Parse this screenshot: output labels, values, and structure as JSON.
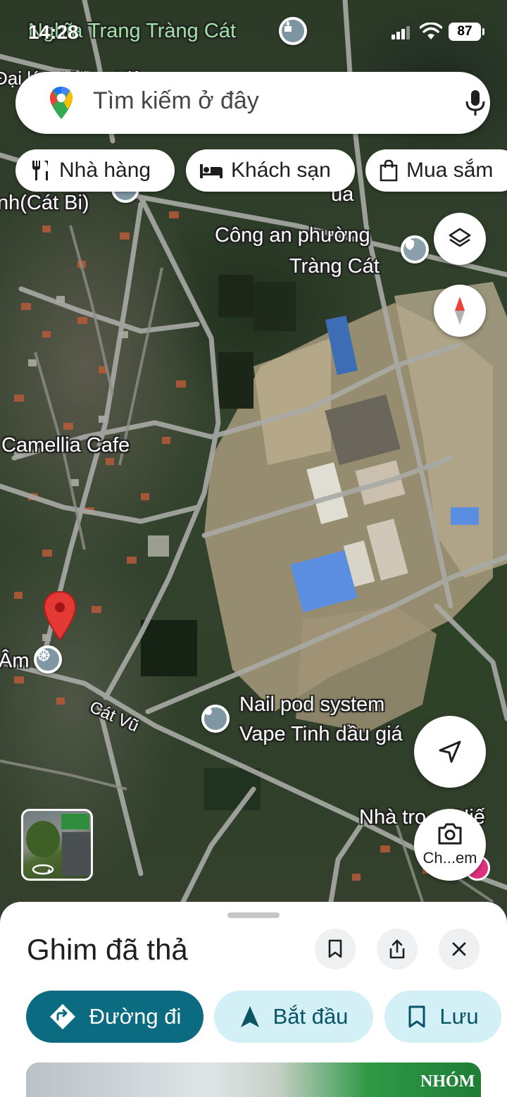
{
  "status_bar": {
    "time": "14:28",
    "battery": "87"
  },
  "search": {
    "placeholder": "Tìm kiếm ở đây"
  },
  "chips": [
    {
      "label": "Nhà hàng",
      "icon": "fork-knife-icon"
    },
    {
      "label": "Khách sạn",
      "icon": "bed-icon"
    },
    {
      "label": "Mua sắm",
      "icon": "shopping-bag-icon"
    }
  ],
  "map_labels": {
    "cemetery": "Nghĩa Trang Tràng Cát",
    "partial_top": "Đại lý ...t Nam Hiệp",
    "airport_partial_1": "ùa",
    "airport_partial_2": "nh(Cát Bi)",
    "police_line1": "Công an phường",
    "police_line2": "Tràng Cát",
    "cafe": "Camellia Cafe",
    "left_partial": "Âm",
    "street": "Cát Vũ",
    "shop_line1": "Nail pod system",
    "shop_line2": "Vape Tinh dầu giá",
    "guesthouse": "Nhà trọ ... Hiế",
    "camera_label": "Ch...em"
  },
  "bottom_sheet": {
    "title": "Ghim đã thả",
    "directions_label": "Đường đi",
    "start_label": "Bắt đầu",
    "save_label": "Lưu",
    "preview_text": "NHÓM"
  },
  "colors": {
    "primary_button": "#0b6b80",
    "secondary_button": "#d3f0f6",
    "pin_red": "#e53935",
    "compass_red": "#ea4335"
  }
}
